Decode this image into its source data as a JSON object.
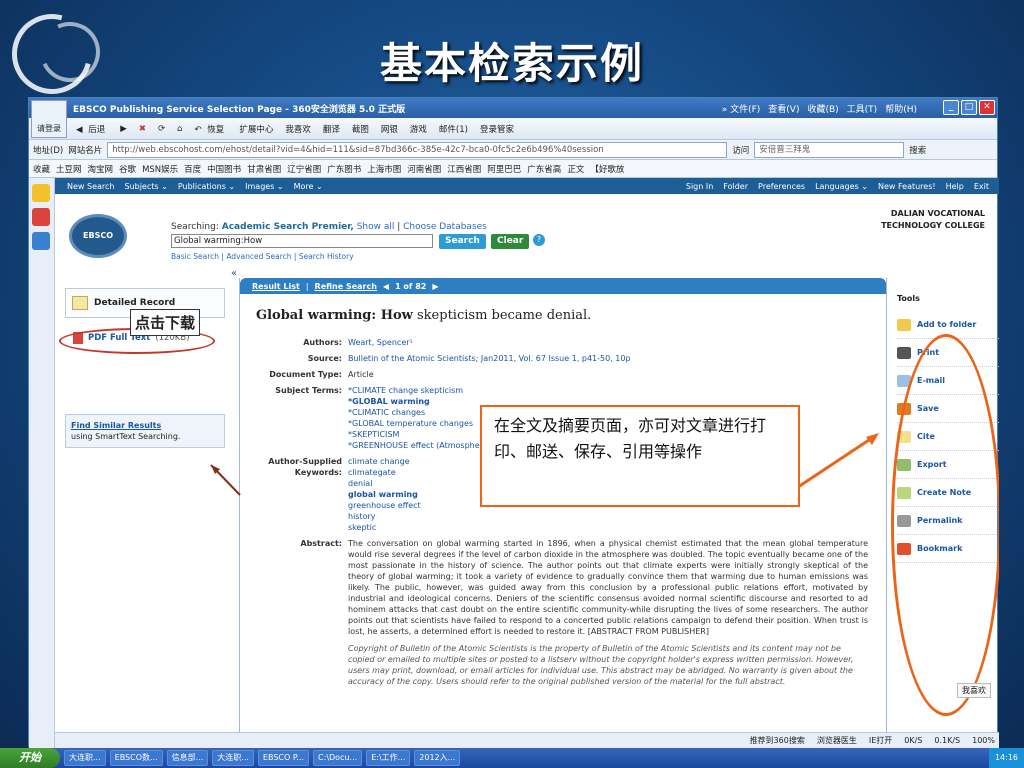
{
  "slide": {
    "title": "基本检索示例"
  },
  "browser": {
    "window_title": "EBSCO Publishing Service Selection Page - 360安全浏览器 5.0 正式版",
    "menu": [
      "» 文件(F)",
      "查看(V)",
      "收藏(B)",
      "工具(T)",
      "帮助(H)"
    ],
    "login_label": "请登录",
    "toolbar": [
      "后退",
      "恢复",
      "扩展中心",
      "我喜欢",
      "翻译",
      "截图",
      "网银",
      "游戏",
      "邮件(1)",
      "登录管家"
    ],
    "address_label": "地址(D)",
    "address_site_label": "网站名片",
    "url": "http://web.ebscohost.com/ehost/detail?vid=4&hid=111&sid=87bd366c-385e-42c7-bca0-0fc5c2e6b496%40session",
    "go_label": "访问",
    "search_value": "安倍晋三拜鬼",
    "search_button": "搜索",
    "favorites": [
      "收藏",
      "土豆网",
      "淘宝网",
      "谷歌",
      "MSN娱乐",
      "百度",
      "中国图书",
      "甘肃省图",
      "辽宁省图",
      "广东图书",
      "上海市图",
      "河南省图",
      "江西省图",
      "阿里巴巴",
      "广东省高",
      "正文",
      "【好歌放"
    ]
  },
  "ebsco": {
    "nav": [
      "New Search",
      "Subjects ⌄",
      "Publications ⌄",
      "Images ⌄",
      "More ⌄"
    ],
    "nav_right": [
      "Sign In",
      "Folder",
      "Preferences",
      "Languages ⌄",
      "New Features!",
      "Help",
      "Exit"
    ],
    "logo_text": "EBSCO",
    "searching_prefix": "Searching:",
    "database": "Academic Search Premier,",
    "show_all": "Show all",
    "choose_databases": "Choose Databases",
    "query": "Global warming:How",
    "search_button": "Search",
    "clear_button": "Clear",
    "basic_search": "Basic Search",
    "advanced_search": "Advanced Search",
    "search_history": "Search History",
    "institution": [
      "DALIAN VOCATIONAL",
      "TECHNOLOGY COLLEGE"
    ]
  },
  "left": {
    "collapse": "«",
    "detailed_record": "Detailed Record",
    "pdf_full_text": "PDF Full Text",
    "pdf_size": "(120KB)",
    "find_similar": "Find Similar Results",
    "find_similar_sub": "using SmartText Searching."
  },
  "record": {
    "result_list": "Result List",
    "refine_search": "Refine Search",
    "pager": "1 of 82",
    "title_bold": "Global warming",
    "title_rest": ": How",
    "title_tail": " skepticism became denial.",
    "authors_label": "Authors:",
    "authors": "Weart, Spencer¹",
    "source_label": "Source:",
    "source": "Bulletin of the Atomic Scientists; Jan2011, Vol. 67 Issue 1, p41-50, 10p",
    "doctype_label": "Document Type:",
    "doctype": "Article",
    "subject_label": "Subject Terms:",
    "subjects": [
      "*CLIMATE change skepticism",
      "*GLOBAL warming",
      "*CLIMATIC changes",
      "*GLOBAL temperature changes",
      "*SKEPTICISM",
      "*GREENHOUSE effect (Atmosphere)"
    ],
    "keywords_label": "Author-Supplied Keywords:",
    "keywords": [
      "climate change",
      "climategate",
      "denial",
      "global warming",
      "greenhouse effect",
      "history",
      "skeptic"
    ],
    "abstract_label": "Abstract:",
    "abstract": "The conversation on global warming started in 1896, when a physical chemist estimated that the mean global temperature would rise several degrees if the level of carbon dioxide in the atmosphere was doubled. The topic eventually became one of the most passionate in the history of science. The author points out that climate experts were initially strongly skeptical of the theory of global warming; it took a variety of evidence to gradually convince them that warming due to human emissions was likely. The public, however, was guided away from this conclusion by a professional public relations effort, motivated by industrial and ideological concerns. Deniers of the scientific consensus avoided normal scientific discourse and resorted to ad hominem attacks that cast doubt on the entire scientific community-while disrupting the lives of some researchers. The author points out that scientists have failed to respond to a concerted public relations campaign to defend their position. When trust is lost, he asserts, a determined effort is needed to restore it. [ABSTRACT FROM PUBLISHER]",
    "copyright": "Copyright of Bulletin of the Atomic Scientists is the property of Bulletin of the Atomic Scientists and its content may not be copied or emailed to multiple sites or posted to a listserv without the copyright holder's express written permission. However, users may print, download, or email articles for individual use. This abstract may be abridged. No warranty is given about the accuracy of the copy. Users should refer to the original published version of the material for the full abstract."
  },
  "tools": {
    "heading": "Tools",
    "items": [
      "Add to folder",
      "Print",
      "E-mail",
      "Save",
      "Cite",
      "Export",
      "Create Note",
      "Permalink",
      "Bookmark"
    ],
    "like": "我喜欢"
  },
  "annotations": {
    "click_download": "点击下载",
    "note": "在全文及摘要页面，亦可对文章进行打印、邮送、保存、引用等操作"
  },
  "statusbar": [
    "推荐到360搜索",
    "浏览器医生",
    "IE打开",
    "0K/S",
    "0.1K/S",
    "100%"
  ],
  "taskbar": {
    "start": "开始",
    "tasks": [
      "大连职...",
      "EBSCO数...",
      "信息部...",
      "大连职...",
      "EBSCO P...",
      "C:\\Docu...",
      "E:\\工作...",
      "2012入..."
    ],
    "clock": "14:16"
  },
  "colors": {
    "ebsco_blue": "#235a8e",
    "callout_red": "#c0392b",
    "callout_orange": "#e8651a"
  }
}
